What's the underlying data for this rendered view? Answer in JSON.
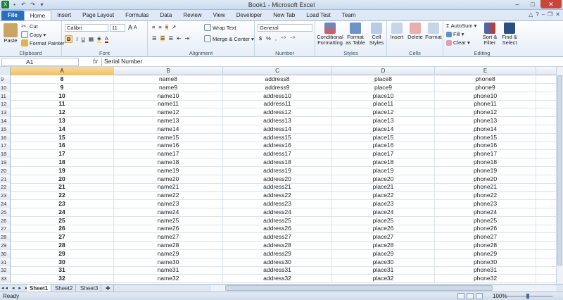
{
  "window": {
    "title": "Book1  -  Microsoft Excel"
  },
  "tabs": [
    "File",
    "Home",
    "Insert",
    "Page Layout",
    "Formulas",
    "Data",
    "Review",
    "View",
    "Developer",
    "New Tab",
    "Load Test",
    "Team"
  ],
  "active_tab": "Home",
  "ribbon": {
    "clipboard": {
      "label": "Clipboard",
      "paste": "Paste",
      "cut": "Cut",
      "copy": "Copy",
      "format_painter": "Format Painter"
    },
    "font": {
      "label": "Font",
      "name": "Calibri",
      "size": "11"
    },
    "alignment": {
      "label": "Alignment",
      "wrap_text": "Wrap Text",
      "merge_center": "Merge & Center"
    },
    "number": {
      "label": "Number",
      "format": "General",
      "currency": "$",
      "percent": "%",
      "comma": ","
    },
    "styles": {
      "label": "Styles",
      "conditional": "Conditional",
      "conditional2": "Formatting",
      "format_table": "Format",
      "format_table2": "as Table",
      "cell_styles": "Cell",
      "cell_styles2": "Styles"
    },
    "cells": {
      "label": "Cells",
      "insert": "Insert",
      "delete": "Delete",
      "format": "Format"
    },
    "editing": {
      "label": "Editing",
      "autosum": "AutoSum",
      "fill": "Fill",
      "clear": "Clear",
      "sort": "Sort &",
      "sort2": "Filter",
      "find": "Find &",
      "find2": "Select"
    }
  },
  "formula_bar": {
    "name_box": "A1",
    "fx": "fx",
    "content": "Serial Number"
  },
  "columns": [
    "A",
    "B",
    "C",
    "D",
    "E"
  ],
  "selected_column": "A",
  "rows": [
    {
      "n": "9",
      "a": "8",
      "b": "name8",
      "c": "address8",
      "d": "place8",
      "e": "phone8"
    },
    {
      "n": "10",
      "a": "9",
      "b": "name9",
      "c": "address9",
      "d": "place9",
      "e": "phone9"
    },
    {
      "n": "11",
      "a": "10",
      "b": "name10",
      "c": "address10",
      "d": "place10",
      "e": "phone10"
    },
    {
      "n": "12",
      "a": "11",
      "b": "name11",
      "c": "address11",
      "d": "place11",
      "e": "phone11"
    },
    {
      "n": "13",
      "a": "12",
      "b": "name12",
      "c": "address12",
      "d": "place12",
      "e": "phone12"
    },
    {
      "n": "14",
      "a": "13",
      "b": "name13",
      "c": "address13",
      "d": "place13",
      "e": "phone13"
    },
    {
      "n": "15",
      "a": "14",
      "b": "name14",
      "c": "address14",
      "d": "place14",
      "e": "phone14"
    },
    {
      "n": "16",
      "a": "15",
      "b": "name15",
      "c": "address15",
      "d": "place15",
      "e": "phone15"
    },
    {
      "n": "17",
      "a": "16",
      "b": "name16",
      "c": "address16",
      "d": "place16",
      "e": "phone16"
    },
    {
      "n": "18",
      "a": "17",
      "b": "name17",
      "c": "address17",
      "d": "place17",
      "e": "phone17"
    },
    {
      "n": "19",
      "a": "18",
      "b": "name18",
      "c": "address18",
      "d": "place18",
      "e": "phone18"
    },
    {
      "n": "20",
      "a": "19",
      "b": "name19",
      "c": "address19",
      "d": "place19",
      "e": "phone19"
    },
    {
      "n": "21",
      "a": "20",
      "b": "name20",
      "c": "address20",
      "d": "place20",
      "e": "phone20"
    },
    {
      "n": "22",
      "a": "21",
      "b": "name21",
      "c": "address21",
      "d": "place21",
      "e": "phone21"
    },
    {
      "n": "23",
      "a": "22",
      "b": "name22",
      "c": "address22",
      "d": "place22",
      "e": "phone22"
    },
    {
      "n": "24",
      "a": "23",
      "b": "name23",
      "c": "address23",
      "d": "place23",
      "e": "phone23"
    },
    {
      "n": "25",
      "a": "24",
      "b": "name24",
      "c": "address24",
      "d": "place24",
      "e": "phone24"
    },
    {
      "n": "26",
      "a": "25",
      "b": "name25",
      "c": "address25",
      "d": "place25",
      "e": "phone25"
    },
    {
      "n": "27",
      "a": "26",
      "b": "name26",
      "c": "address26",
      "d": "place26",
      "e": "phone26"
    },
    {
      "n": "28",
      "a": "27",
      "b": "name27",
      "c": "address27",
      "d": "place27",
      "e": "phone27"
    },
    {
      "n": "29",
      "a": "28",
      "b": "name28",
      "c": "address28",
      "d": "place28",
      "e": "phone28"
    },
    {
      "n": "30",
      "a": "29",
      "b": "name29",
      "c": "address29",
      "d": "place29",
      "e": "phone29"
    },
    {
      "n": "31",
      "a": "30",
      "b": "name30",
      "c": "address30",
      "d": "place30",
      "e": "phone30"
    },
    {
      "n": "32",
      "a": "31",
      "b": "name31",
      "c": "address31",
      "d": "place31",
      "e": "phone31"
    },
    {
      "n": "33",
      "a": "32",
      "b": "name32",
      "c": "address32",
      "d": "place32",
      "e": "phone32"
    }
  ],
  "sheets": [
    "Sheet1",
    "Sheet2",
    "Sheet3"
  ],
  "active_sheet": "Sheet1",
  "status": {
    "ready": "Ready",
    "zoom": "100%"
  },
  "colors": {
    "file_tab": "#2a6fbe",
    "selected_header": "#f1c15f",
    "close_button": "#c9463d"
  }
}
